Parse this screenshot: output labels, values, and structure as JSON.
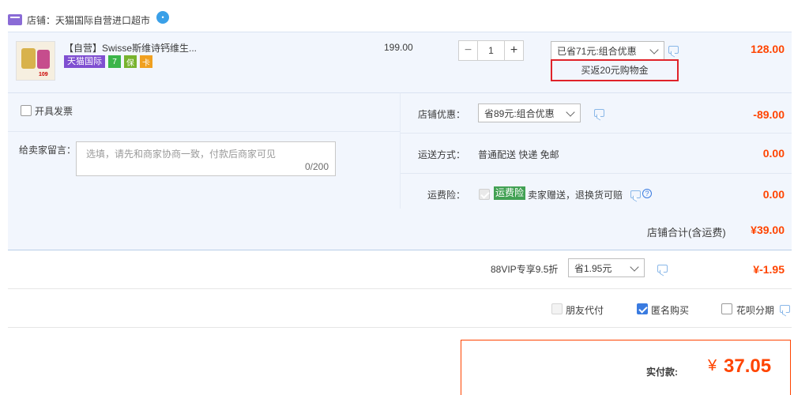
{
  "store": {
    "label": "店铺：",
    "name": "天猫国际自营进口超市",
    "wangwang_icon": "chat-bubble-icon"
  },
  "product": {
    "title": "【自营】Swisse斯维诗钙维生...",
    "badges": [
      "天猫国际",
      "7",
      "保",
      "卡"
    ],
    "thumb_price": "109",
    "unit_price": "199.00",
    "quantity": "1",
    "qty_minus": "−",
    "qty_plus": "+",
    "promo_select": "已省71元:组合优惠",
    "cashback": "买返20元购物金",
    "subtotal": "128.00"
  },
  "invoice": {
    "label": "开具发票",
    "checked": false
  },
  "message": {
    "label": "给卖家留言：",
    "placeholder": "选填，请先和商家协商一致，付款后商家可见",
    "count": "0/200"
  },
  "store_discount": {
    "label": "店铺优惠：",
    "select": "省89元:组合优惠",
    "amount": "-89.00"
  },
  "shipping": {
    "label": "运送方式：",
    "value": "普通配送 快递 免邮",
    "amount": "0.00"
  },
  "insurance": {
    "label": "运费险：",
    "tag": "运费险",
    "text": "卖家赠送，退换货可赔",
    "help": "?",
    "amount": "0.00"
  },
  "store_total": {
    "label": "店铺合计(含运费)",
    "amount": "¥39.00"
  },
  "vip": {
    "label": "88VIP专享9.5折",
    "select": "省1.95元",
    "amount": "¥-1.95"
  },
  "options": [
    {
      "label": "朋友代付",
      "checked": false,
      "disabled": true
    },
    {
      "label": "匿名购买",
      "checked": true,
      "disabled": false
    },
    {
      "label": "花呗分期",
      "checked": false,
      "disabled": false
    }
  ],
  "payment": {
    "label": "实付款:",
    "currency": "¥",
    "amount": "37.05"
  },
  "colors": {
    "accent_red": "#ff4400",
    "row_bg": "#f2f6fd",
    "tmall_purple": "#7f4fd1",
    "checkbox_blue": "#3a7be0",
    "insurance_green": "#42a154",
    "highlight_box": "#e0232a"
  }
}
